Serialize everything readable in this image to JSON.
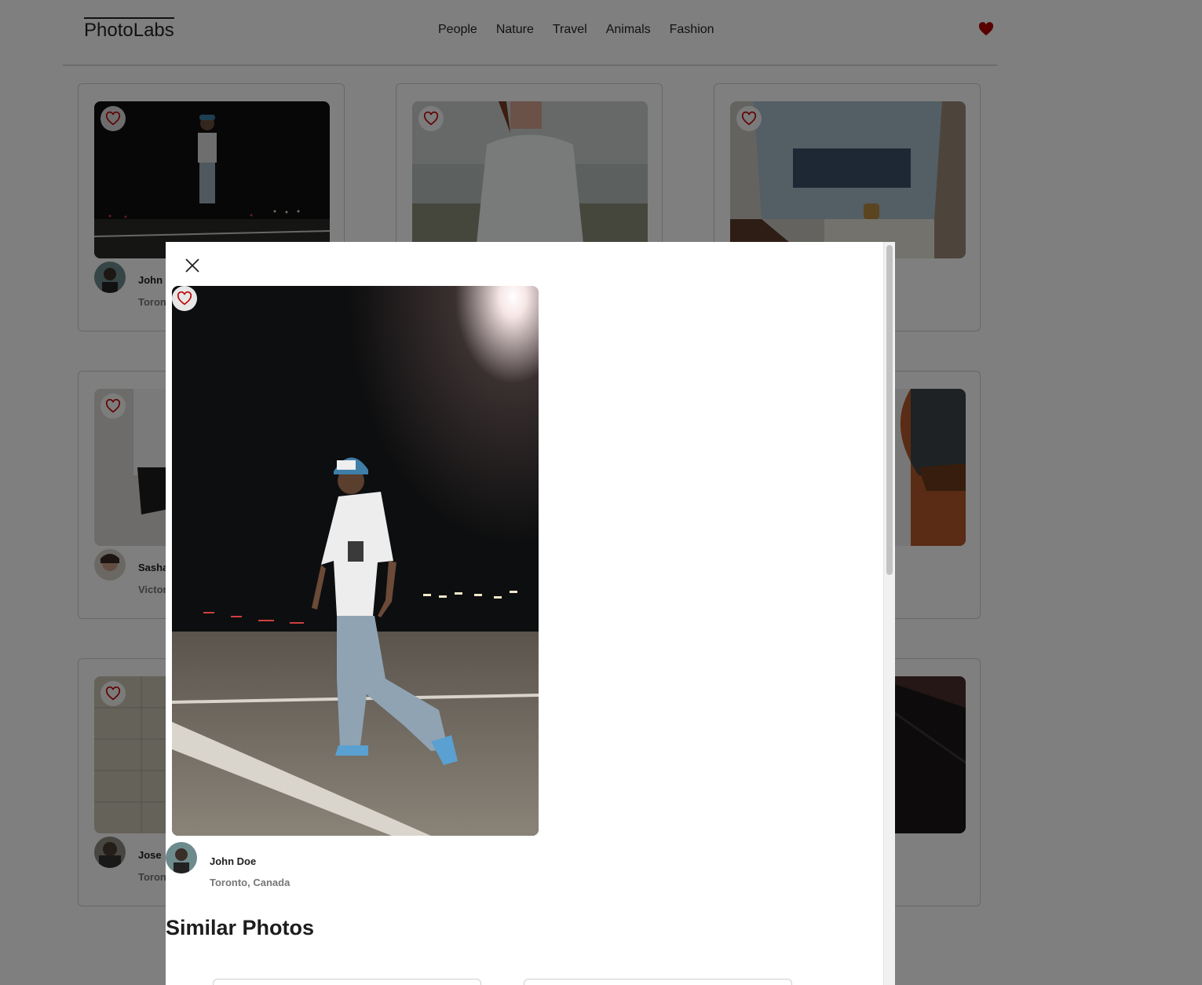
{
  "app": {
    "logo": "PhotoLabs"
  },
  "nav": {
    "topics": [
      "People",
      "Nature",
      "Travel",
      "Animals",
      "Fashion"
    ],
    "fav_icon": "heart-filled-icon",
    "fav_color": "#b30000"
  },
  "grid": {
    "cards": [
      {
        "name": "John Doe",
        "location": "Toronto, Canada"
      },
      {
        "name": "",
        "location": ""
      },
      {
        "name": "",
        "location": ""
      },
      {
        "name": "Sasha",
        "location": "Victoria"
      },
      {
        "name": "",
        "location": ""
      },
      {
        "name": "",
        "location": ""
      },
      {
        "name": "Jose",
        "location": "Toronto"
      },
      {
        "name": "",
        "location": ""
      },
      {
        "name": "",
        "location": ""
      }
    ]
  },
  "modal": {
    "close_icon": "close-icon",
    "photo_alt": "Man in blue cap walking on a parking lot at night",
    "user": {
      "name": "John Doe",
      "location": "Toronto, Canada"
    },
    "similar_title": "Similar Photos"
  },
  "colors": {
    "accent": "#c00000",
    "overlay": "rgba(0,0,0,0.5)"
  }
}
